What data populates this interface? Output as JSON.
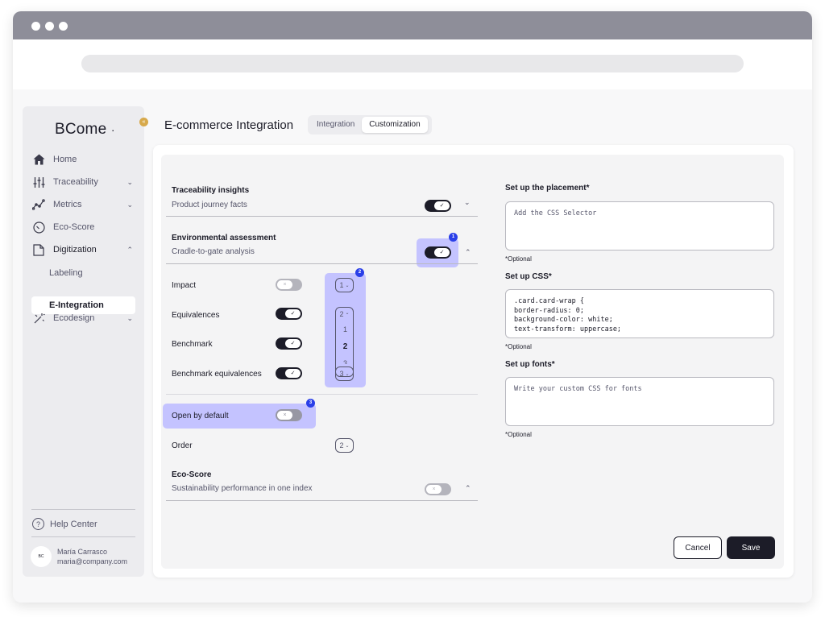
{
  "sidebar": {
    "logo": "BCome",
    "collapse": "«",
    "items": [
      {
        "label": "Home",
        "icon": "home-icon"
      },
      {
        "label": "Traceability",
        "icon": "sliders-icon",
        "chevron": "⌄"
      },
      {
        "label": "Metrics",
        "icon": "chart-line-icon",
        "chevron": "⌄"
      },
      {
        "label": "Eco-Score",
        "icon": "gauge-icon"
      },
      {
        "label": "Digitization",
        "icon": "document-icon",
        "chevron": "⌃"
      },
      {
        "label": "Ecodesign",
        "icon": "magic-wand-icon",
        "chevron": "⌄"
      }
    ],
    "subitems": [
      {
        "label": "Labeling"
      },
      {
        "label": "E-Integration",
        "active": true
      }
    ],
    "help": "Help Center",
    "user": {
      "initials": "BC",
      "name": "María Carrasco",
      "email": "maria@company.com"
    }
  },
  "header": {
    "title": "E-commerce Integration",
    "tabs": [
      {
        "label": "Integration",
        "active": false
      },
      {
        "label": "Customization",
        "active": true
      }
    ]
  },
  "sections": {
    "traceability": {
      "title": "Traceability insights",
      "subtitle": "Product journey facts",
      "enabled": true
    },
    "environmental": {
      "title": "Environmental assessment",
      "subtitle": "Cradle-to-gate analysis",
      "enabled": true,
      "badge": "1"
    },
    "eco_score": {
      "title": "Eco-Score",
      "subtitle": "Sustainability performance in one index",
      "enabled": false
    }
  },
  "metrics_rows": [
    {
      "label": "Impact",
      "enabled": false,
      "order": "1"
    },
    {
      "label": "Equivalences",
      "enabled": true,
      "order": "2"
    },
    {
      "label": "Benchmark",
      "enabled": true
    },
    {
      "label": "Benchmark equivalences",
      "enabled": true,
      "order": "3"
    }
  ],
  "order_dropdown": {
    "badge": "2",
    "options": [
      "1",
      "2",
      "3"
    ]
  },
  "open_by_default": {
    "label": "Open by default",
    "enabled": false,
    "badge": "3"
  },
  "order": {
    "label": "Order",
    "value": "2"
  },
  "placement": {
    "label": "Set up the placement*",
    "placeholder": "Add the CSS Selector",
    "optional": "*Optional"
  },
  "css": {
    "label": "Set up CSS*",
    "value": ".card.card-wrap {\nborder-radius: 0;\nbackground-color: white;\ntext-transform: uppercase;",
    "optional": "*Optional"
  },
  "fonts": {
    "label": "Set up fonts*",
    "placeholder": "Write your custom CSS for fonts",
    "optional": "*Optional"
  },
  "actions": {
    "cancel": "Cancel",
    "save": "Save"
  },
  "glyphs": {
    "check": "✓",
    "cross": "×",
    "chev_down": "⌄",
    "chev_up": "⌃",
    "dot": "·"
  },
  "colors": {
    "primary": "#1c1c28",
    "highlight": "#c4c3ff",
    "badge": "#2a3fe8",
    "accent": "#d7a94b"
  }
}
